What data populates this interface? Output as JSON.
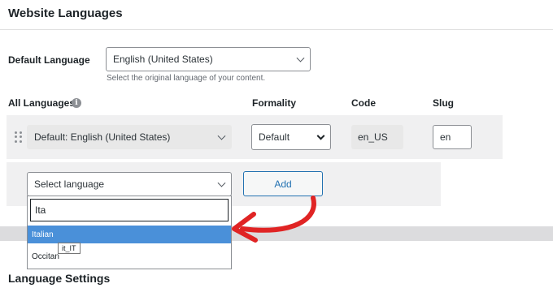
{
  "header": {
    "title": "Website Languages"
  },
  "default_language": {
    "label": "Default Language",
    "value": "English (United States)",
    "hint": "Select the original language of your content."
  },
  "columns": {
    "all_languages": "All Languages",
    "info_icon": "i",
    "formality": "Formality",
    "code": "Code",
    "slug": "Slug"
  },
  "language_row": {
    "language": "Default: English (United States)",
    "formality": "Default",
    "code": "en_US",
    "slug": "en"
  },
  "add_row": {
    "select_placeholder": "Select language",
    "add_label": "Add",
    "search_value": "Ita",
    "options": [
      {
        "label": "Italian",
        "highlighted": true
      },
      {
        "label": "Occitan",
        "highlighted": false
      }
    ],
    "tooltip": "it_IT"
  },
  "language_settings": {
    "title": "Language Settings"
  },
  "colors": {
    "accent": "#2271b1",
    "highlight": "#4a90d9",
    "arrow": "#e02424"
  }
}
